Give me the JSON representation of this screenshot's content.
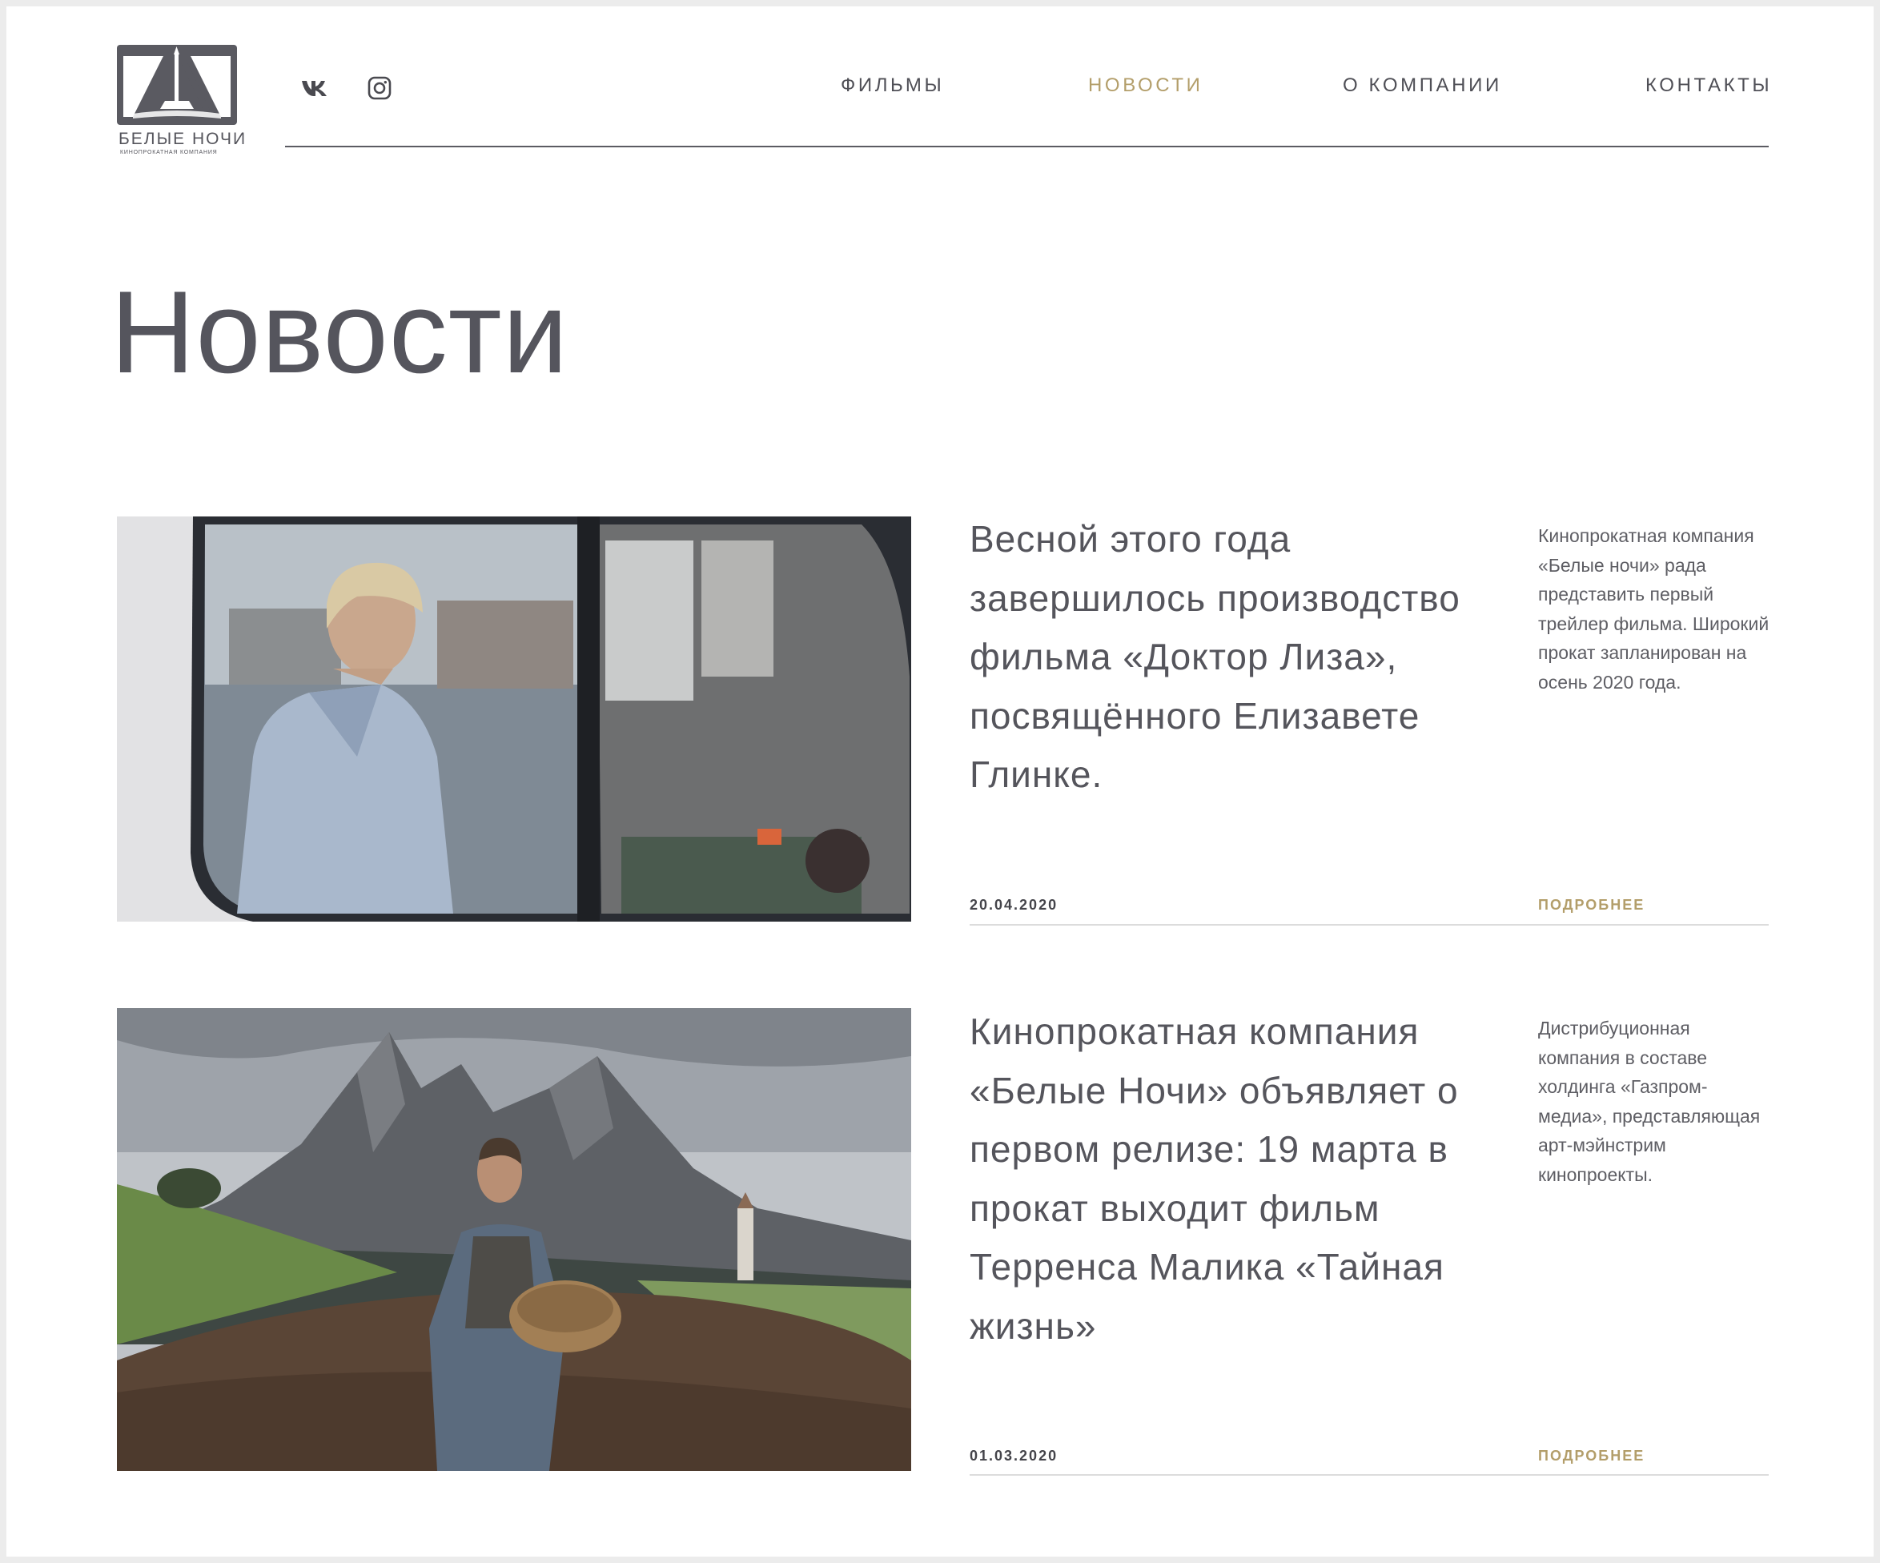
{
  "brand": {
    "name": "БЕЛЫЕ НОЧИ",
    "tagline": "КИНОПРОКАТНАЯ КОМПАНИЯ",
    "logo_icon": "white-nights-logo",
    "accent_color": "#b39e6a",
    "text_color": "#55555c"
  },
  "social": [
    {
      "name": "vk",
      "icon": "vk-icon"
    },
    {
      "name": "instagram",
      "icon": "instagram-icon"
    }
  ],
  "nav": {
    "items": [
      {
        "label": "ФИЛЬМЫ",
        "active": false
      },
      {
        "label": "НОВОСТИ",
        "active": true
      },
      {
        "label": "О КОМПАНИИ",
        "active": false
      },
      {
        "label": "КОНТАКТЫ",
        "active": false
      }
    ]
  },
  "page": {
    "title": "Новости"
  },
  "news": [
    {
      "title": "Весной этого года завершилось производство фильма «Доктор Лиза», посвящённого Елизавете Глинке.",
      "description": "Кинопрокатная компания «Белые ночи» рада представить первый трейлер фильма. Широкий прокат запланирован на осень 2020 года.",
      "date": "20.04.2020",
      "more_label": "ПОДРОБНЕЕ",
      "image": "woman-in-car-behind-rainy-window"
    },
    {
      "title": "Кинопрокатная компания «Белые Ночи» объявляет о первом релизе: 19 марта в прокат выходит фильм Терренса Малика «Тайная жизнь»",
      "description": "Дистрибуционная компания в составе холдинга «Газпром-медиа», представляющая арт-мэйнстрим кинопроекты.",
      "date": "01.03.2020",
      "more_label": "ПОДРОБНЕЕ",
      "image": "man-sowing-field-in-mountains"
    }
  ]
}
